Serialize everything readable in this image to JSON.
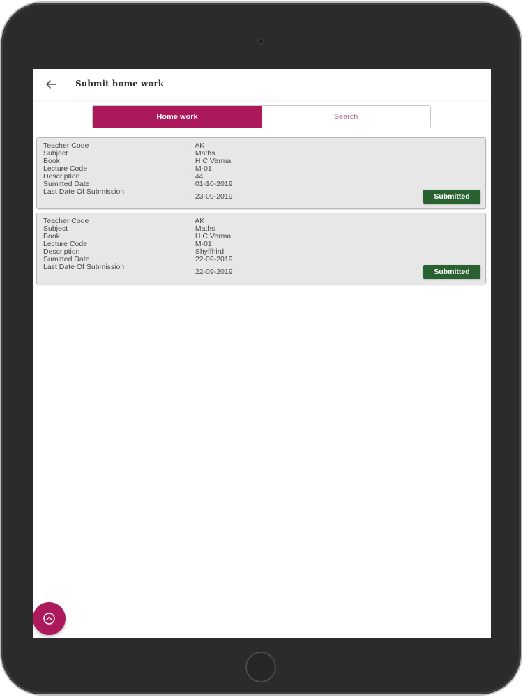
{
  "header": {
    "back_icon": "arrow-left-icon",
    "title": "Submit home work"
  },
  "tabs": [
    {
      "label": "Home work",
      "active": true
    },
    {
      "label": "Search",
      "active": false
    }
  ],
  "colors": {
    "accent": "#ad1a5c",
    "status_submitted": "#2a6130",
    "card_background": "#e7e7e7"
  },
  "field_labels": {
    "teacher_code": "Teacher Code",
    "subject": "Subject",
    "book": "Book",
    "lecture_code": "Lecture Code",
    "description": "Description",
    "submitted_date": "Sumitted Date",
    "last_date": "Last Date Of Submission"
  },
  "homework": [
    {
      "teacher_code": ": AK",
      "subject": ": Maths",
      "book": ": H C Verma",
      "lecture_code": ": M-01",
      "description": ": 44",
      "submitted_date": ": 01-10-2019",
      "last_date": ": 23-09-2019",
      "status": "Submitted"
    },
    {
      "teacher_code": ": AK",
      "subject": ": Maths",
      "book": ": H C Verma",
      "lecture_code": ": M-01",
      "description": ": Shyffhird",
      "submitted_date": ": 22-09-2019",
      "last_date": ": 22-09-2019",
      "status": "Submitted"
    }
  ],
  "fab": {
    "icon": "chevron-up-circle-icon"
  }
}
